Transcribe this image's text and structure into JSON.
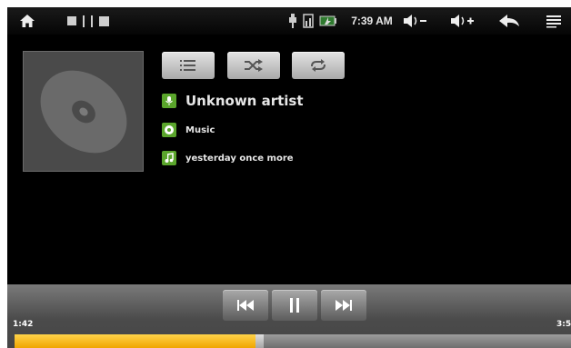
{
  "statusbar": {
    "clock": "7:39 AM",
    "icons": [
      "home-icon",
      "notification-icons",
      "usb-icon",
      "sd-card-icon",
      "battery-icon",
      "volume-down-icon",
      "volume-up-icon",
      "back-icon",
      "menu-icon"
    ]
  },
  "controls": {
    "top_buttons": [
      "list-icon",
      "shuffle-icon",
      "repeat-icon"
    ]
  },
  "track": {
    "artist": "Unknown artist",
    "album": "Music",
    "title": "yesterday once more"
  },
  "playback": {
    "elapsed": "1:42",
    "total": "3:5",
    "progress_fraction": 0.44,
    "buttons": [
      "previous-icon",
      "pause-icon",
      "next-icon"
    ]
  },
  "colors": {
    "background": "#000000",
    "progress_fill": "#f5b800",
    "info_icon_green": "#5aa52b"
  }
}
